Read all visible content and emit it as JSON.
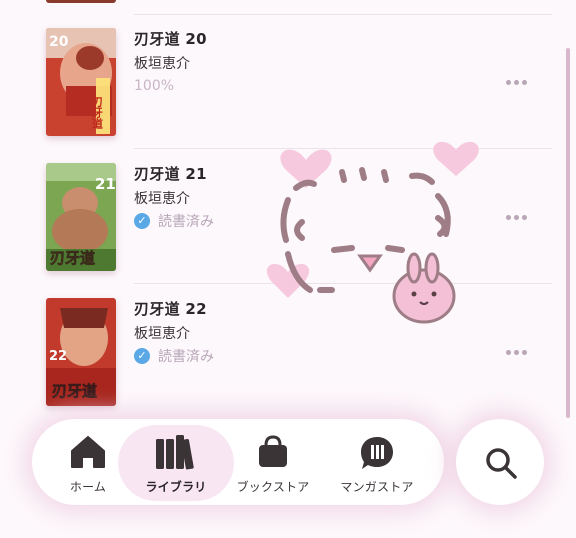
{
  "books": [
    {
      "title": "刃牙道 20",
      "author": "板垣恵介",
      "progress": "100%",
      "volume_badge": "20",
      "cover_logo": "刃牙道",
      "cover_colors": {
        "bg": "#d24a3a",
        "accent": "#e9b0a0"
      }
    },
    {
      "title": "刃牙道 21",
      "author": "板垣恵介",
      "status": "読書済み",
      "volume_badge": "21",
      "cover_logo": "刃牙道",
      "cover_colors": {
        "bg": "#6f9a46",
        "accent": "#c9a07a"
      }
    },
    {
      "title": "刃牙道 22",
      "author": "板垣恵介",
      "status": "読書済み",
      "volume_badge": "22",
      "cover_logo": "刃牙道",
      "cover_colors": {
        "bg": "#c9382e",
        "accent": "#e0a487"
      }
    }
  ],
  "nav": {
    "items": [
      {
        "label": "ホーム",
        "icon": "home-icon"
      },
      {
        "label": "ライブラリ",
        "icon": "library-icon",
        "active": true
      },
      {
        "label": "ブックストア",
        "icon": "bag-icon"
      },
      {
        "label": "マンガストア",
        "icon": "manga-icon"
      }
    ],
    "search_icon": "search-icon"
  },
  "colors": {
    "accent_pink": "#f8e6f3",
    "read_check": "#5aa9e6",
    "muted_text": "#b7a6b8"
  }
}
